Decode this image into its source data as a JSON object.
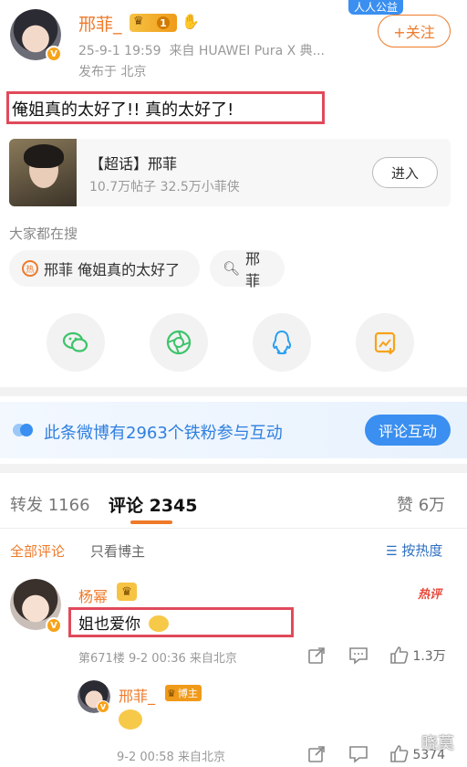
{
  "post": {
    "author": "邢菲_",
    "level_badge": "1",
    "promo_badge": "人人公益",
    "follow_label": "+关注",
    "meta_time": "25-9-1 19:59",
    "meta_source": "来自 HUAWEI Pura X 典...",
    "location": "发布于 北京",
    "text": "俺姐真的太好了!! 真的太好了!"
  },
  "topic_card": {
    "title": "【超话】邢菲",
    "stats": "10.7万帖子 32.5万小菲侠",
    "enter_label": "进入"
  },
  "search": {
    "heading": "大家都在搜",
    "chip1": "邢菲 俺姐真的太好了",
    "chip2": "邢菲"
  },
  "share_icons": [
    "wechat-icon",
    "moments-icon",
    "qq-icon",
    "save-image-icon"
  ],
  "fans_banner": {
    "text": "此条微博有2963个铁粉参与互动",
    "button": "评论互动"
  },
  "tabs": {
    "repost": "转发 1166",
    "comment": "评论 2345",
    "like": "赞 6万"
  },
  "filters": {
    "all": "全部评论",
    "author_only": "只看博主",
    "sort": "按热度"
  },
  "comment1": {
    "name": "杨幂",
    "hot_tag": "热评",
    "text": "姐也爱你",
    "meta": "第671楼 9-2 00:36 来自北京",
    "likes": "1.3万"
  },
  "reply1": {
    "name": "邢菲_",
    "tag": "博主",
    "meta": "9-2 00:58 来自北京",
    "likes": "5374"
  },
  "watermark": "晓莫",
  "colors": {
    "accent": "#ee7a2a",
    "blue": "#3a8ff0",
    "highlight_box": "#e04a5a"
  }
}
